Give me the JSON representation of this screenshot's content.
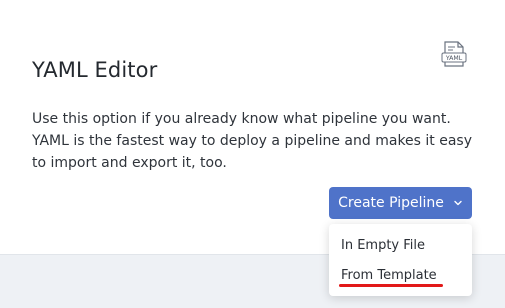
{
  "card": {
    "title": "YAML Editor",
    "description": "Use this option if you already know what pipeline you want. YAML is the fastest way to deploy a pipeline and makes it easy to import and export it, too.",
    "icon": "yaml-file-icon",
    "icon_text": "YAML"
  },
  "create_button": {
    "label": "Create Pipeline",
    "icon": "chevron-down-icon",
    "color": "#4f73c9"
  },
  "menu": {
    "items": [
      {
        "label": "In Empty File"
      },
      {
        "label": "From Template"
      }
    ]
  },
  "annotation": {
    "highlight_color": "#e21818"
  }
}
